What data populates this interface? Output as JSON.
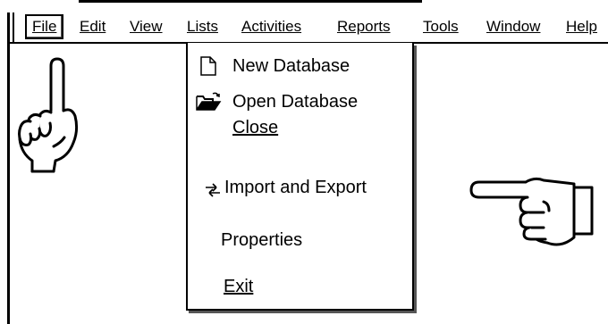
{
  "menubar": {
    "items": [
      {
        "label": "File",
        "active": true
      },
      {
        "label": "Edit"
      },
      {
        "label": "View"
      },
      {
        "label": "Lists"
      },
      {
        "label": "Activities"
      },
      {
        "label": "Reports"
      },
      {
        "label": "Tools"
      },
      {
        "label": "Window"
      },
      {
        "label": "Help"
      }
    ]
  },
  "file_menu": {
    "items": [
      {
        "label": "New Database",
        "icon": "new-document-icon"
      },
      {
        "label": "Open Database",
        "icon": "open-folder-icon"
      },
      {
        "label": "Close"
      },
      {
        "label": "Import and Export",
        "icon": "import-export-icon"
      },
      {
        "label": "Properties"
      },
      {
        "label": "Exit"
      }
    ]
  },
  "decorations": {
    "left_hand": "pointing-up-hand-icon",
    "right_hand": "pointing-left-hand-icon"
  }
}
